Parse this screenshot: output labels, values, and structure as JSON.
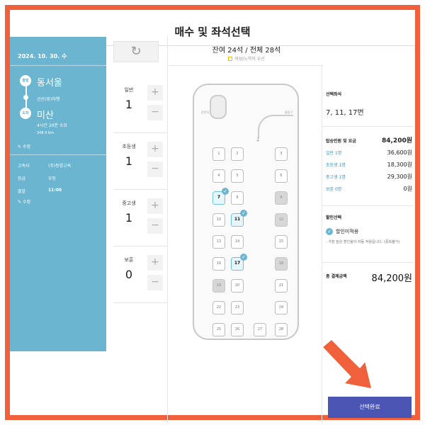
{
  "page_title": "매수 및 좌석선택",
  "trip": {
    "date": "2024. 10. 30. 수",
    "departure_badge": "출발",
    "departure": "동서울",
    "via": "선산(휴)하행",
    "arrival_badge": "도착",
    "arrival": "미산",
    "duration": "4시간 20분 소요",
    "distance": "348.9 Km",
    "edit_label": "수정",
    "company_label": "고속사",
    "company": "(주)동양고속",
    "grade_label": "등급",
    "grade": "우등",
    "time_label": "출발",
    "time": "11:00",
    "edit_label2": "수정"
  },
  "refresh_icon": "refresh-icon",
  "counters": [
    {
      "label": "일반",
      "value": "1"
    },
    {
      "label": "초등생",
      "value": "1"
    },
    {
      "label": "중고생",
      "value": "1"
    },
    {
      "label": "보훈",
      "value": "0"
    }
  ],
  "counter_plus": "+",
  "counter_minus": "−",
  "seat_header": {
    "availability": "잔여 24석 / 전체 28석",
    "priority_note": "여성/노약자 우선"
  },
  "bus": {
    "driver_label": "운전석",
    "door_label": "출입구",
    "arrow": "↓"
  },
  "seats": [
    {
      "n": "1",
      "state": "free"
    },
    {
      "n": "2",
      "state": "free"
    },
    {
      "n": "3",
      "state": "free"
    },
    {
      "n": "4",
      "state": "free"
    },
    {
      "n": "5",
      "state": "free"
    },
    {
      "n": "6",
      "state": "free"
    },
    {
      "n": "7",
      "state": "selected"
    },
    {
      "n": "8",
      "state": "free"
    },
    {
      "n": "9",
      "state": "taken"
    },
    {
      "n": "10",
      "state": "free"
    },
    {
      "n": "11",
      "state": "selected"
    },
    {
      "n": "12",
      "state": "taken"
    },
    {
      "n": "13",
      "state": "free"
    },
    {
      "n": "14",
      "state": "free"
    },
    {
      "n": "15",
      "state": "free"
    },
    {
      "n": "16",
      "state": "free"
    },
    {
      "n": "17",
      "state": "selected"
    },
    {
      "n": "18",
      "state": "taken"
    },
    {
      "n": "19",
      "state": "taken"
    },
    {
      "n": "20",
      "state": "free"
    },
    {
      "n": "21",
      "state": "free"
    },
    {
      "n": "22",
      "state": "free"
    },
    {
      "n": "23",
      "state": "free"
    },
    {
      "n": "24",
      "state": "free"
    },
    {
      "n": "25",
      "state": "free"
    },
    {
      "n": "26",
      "state": "free"
    },
    {
      "n": "27",
      "state": "free"
    },
    {
      "n": "28",
      "state": "free"
    }
  ],
  "summary": {
    "selected_title": "선택좌석",
    "selected_seats": "7, 11, 17번",
    "fare_title": "탑승인원 및 요금",
    "fare_total": "84,200원",
    "fares": [
      {
        "label": "일반 1명",
        "amount": "36,600원"
      },
      {
        "label": "초등생 1명",
        "amount": "18,300원"
      },
      {
        "label": "중고생 1명",
        "amount": "29,300원"
      },
      {
        "label": "보훈 0명",
        "amount": "0원"
      }
    ],
    "discount_title": "할인선택",
    "discount_option": "할인미적용",
    "discount_note": "- 가장 높은 할인율이 자동 적용됩니다. (중복불가)",
    "total_label": "총 결제금액",
    "total_amount": "84,200원"
  },
  "complete_button": "선택완료",
  "colors": {
    "frame": "#f0603a",
    "info_panel": "#6cb5d0",
    "selected_seat": "#6cc4dc",
    "button": "#4a55b4"
  }
}
